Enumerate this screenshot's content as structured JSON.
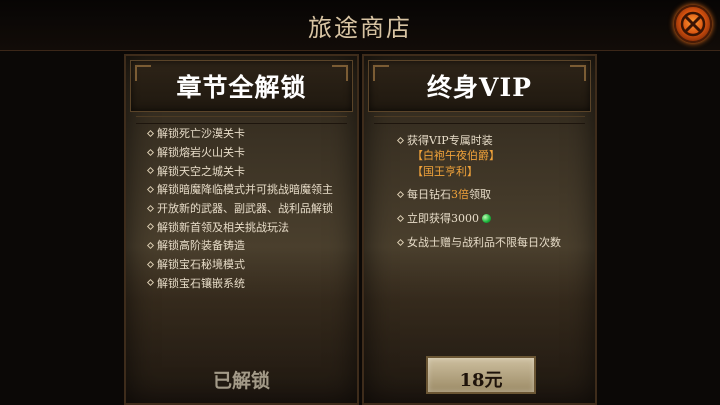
{
  "header": {
    "title": "旅途商店"
  },
  "close_button": {
    "icon": "close-icon",
    "color": "#e06a17"
  },
  "chapter_panel": {
    "title": "章节全解锁",
    "features": [
      "解锁死亡沙漠关卡",
      "解锁熔岩火山关卡",
      "解锁天空之城关卡",
      "解锁暗魔降临模式并可挑战暗魔领主",
      "开放新的武器、副武器、战利品解锁",
      "解锁新首领及相关挑战玩法",
      "解锁高阶装备铸造",
      "解锁宝石秘境模式",
      "解锁宝石镶嵌系统"
    ],
    "status_label": "已解锁"
  },
  "vip_panel": {
    "title": "终身VIP",
    "benefits": [
      {
        "text": "获得VIP专属时装",
        "sub": [
          "【白袍午夜伯爵】",
          "【国王亨利】"
        ]
      },
      {
        "prefix": "每日钻石 ",
        "highlight": "3倍",
        "suffix": " 领取"
      },
      {
        "prefix": "立即获得 ",
        "amount": "3000",
        "icon": "green-gem-icon"
      },
      {
        "text": "女战士赠与战利品不限每日次数"
      }
    ],
    "price_label": "18元"
  }
}
